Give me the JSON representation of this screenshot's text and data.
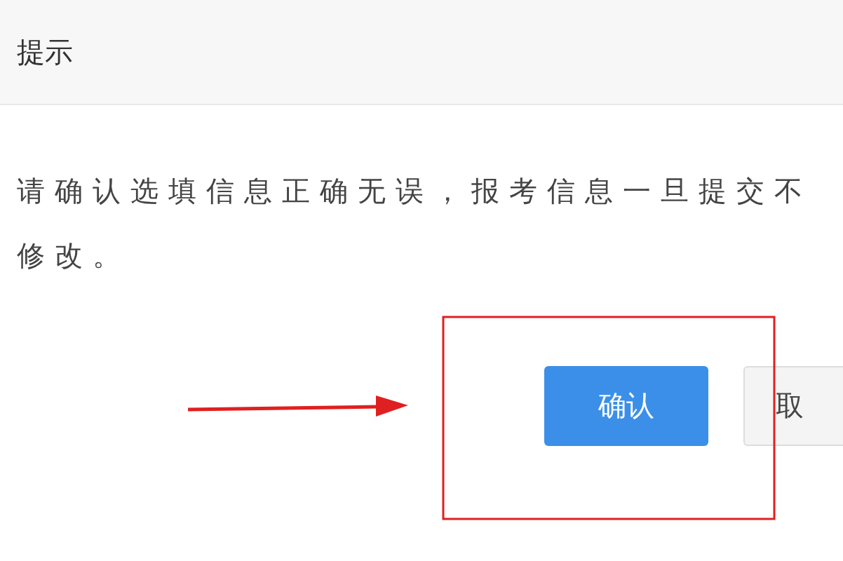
{
  "dialog": {
    "title": "提示",
    "message_lines": [
      "请确认选填信息正确无误，报考信息一旦提交不",
      "修改。"
    ],
    "buttons": [
      {
        "label": "确认",
        "kind": "primary"
      },
      {
        "label": "取",
        "kind": "default"
      }
    ]
  }
}
